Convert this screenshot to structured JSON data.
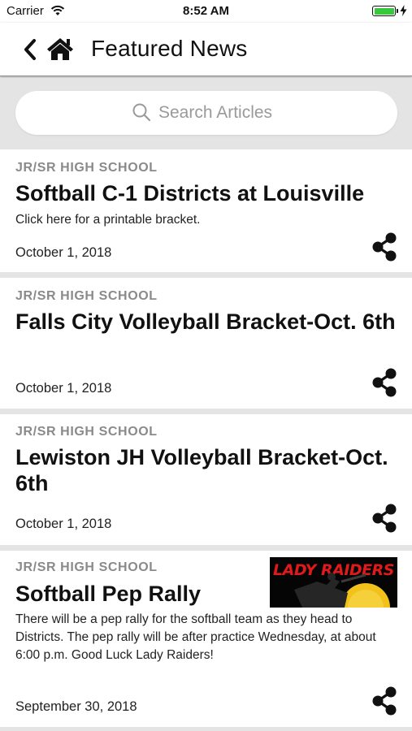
{
  "status_bar": {
    "carrier": "Carrier",
    "time": "8:52 AM",
    "battery_level": 1.0,
    "battery_color": "#38c83c",
    "wifi_icon": "wifi-icon",
    "charging_icon": "bolt-icon"
  },
  "nav": {
    "back_icon": "chevron-left-icon",
    "home_icon": "home-icon",
    "title": "Featured News"
  },
  "search": {
    "placeholder": "Search Articles",
    "value": ""
  },
  "articles": [
    {
      "category": "JR/SR HIGH SCHOOL",
      "title": "Softball C-1 Districts at Louisville",
      "description": "Click here for a printable bracket.",
      "date": "October 1, 2018"
    },
    {
      "category": "JR/SR HIGH SCHOOL",
      "title": "Falls City Volleyball Bracket-Oct. 6th",
      "date": "October 1, 2018"
    },
    {
      "category": "JR/SR HIGH SCHOOL",
      "title": "Lewiston JH Volleyball Bracket-Oct. 6th",
      "date": "October 1, 2018"
    },
    {
      "category": "JR/SR HIGH SCHOOL",
      "title": "Softball Pep Rally",
      "description": "There will be a pep rally for the softball team as they head to Districts.  The pep rally will be after practice Wednesday, at about 6:00 p.m. Good Luck Lady Raiders!",
      "date": "September 30, 2018",
      "thumbnail_text": "LADY RAIDERS"
    }
  ],
  "share_icon": "share-icon",
  "colors": {
    "background": "#e4e4e4",
    "category": "#8a8a8a",
    "thumbnail_text": "#e01a1a"
  }
}
